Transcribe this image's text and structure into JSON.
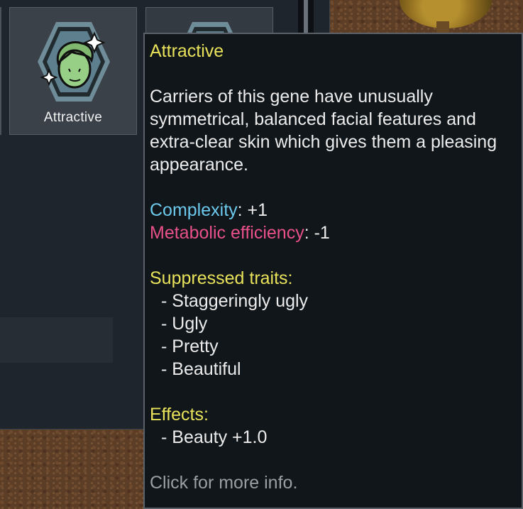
{
  "gene_panel": {
    "selected_gene": {
      "label": "Attractive",
      "icon": "attractive-face-icon"
    },
    "other_gene": {
      "icon": "gene-hexagon-icon"
    }
  },
  "tooltip": {
    "title": "Attractive",
    "description": "Carriers of this gene have unusually symmetrical, balanced facial features and extra-clear skin which gives them a pleasing appearance.",
    "complexity_label": "Complexity",
    "complexity_value": ": +1",
    "metabolic_label": "Metabolic efficiency",
    "metabolic_value": ": -1",
    "suppressed_heading": "Suppressed traits:",
    "suppressed_traits": [
      "- Staggeringly ugly",
      "- Ugly",
      "- Pretty",
      "- Beautiful"
    ],
    "effects_heading": "Effects:",
    "effects": [
      "- Beauty +1.0"
    ],
    "footer": "Click for more info."
  },
  "colors": {
    "title_yellow": "#e8e25a",
    "complexity_blue": "#6cc8ec",
    "metabolic_pink": "#e8508a",
    "footer_grey": "#9a9fa4"
  }
}
